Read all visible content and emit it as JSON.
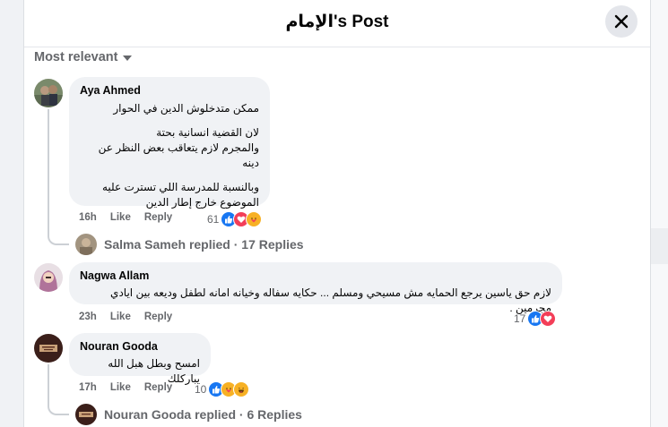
{
  "header": {
    "title": "الإمام's Post",
    "close_icon": "close-icon"
  },
  "sort": {
    "label": "Most relevant"
  },
  "comments": [
    {
      "author": "Aya Ahmed",
      "lines": [
        "ممكن متدخلوش الدين في الحوار",
        "لان القضية انسانية بحتة",
        "والمجرم لازم يتعاقب بعض النظر عن دينه",
        "وبالنسبة للمدرسة اللي تسترت عليه",
        "الموضوع خارج إطار الدين"
      ],
      "time": "16h",
      "like": "Like",
      "reply": "Reply",
      "reactions": "61",
      "replies": {
        "text": "Salma Sameh replied · 17 Replies"
      }
    },
    {
      "author": "Nagwa Allam",
      "lines": [
        "لازم حق ياسين يرجع الحمايه مش مسيحي ومسلم ... حكايه سفاله وخيانه امانه لطفل وديعه بين ايادي مجرمين ."
      ],
      "time": "23h",
      "like": "Like",
      "reply": "Reply",
      "reactions": "17"
    },
    {
      "author": "Nouran Gooda",
      "lines": [
        "امسح وبطل هبل الله يباركلك"
      ],
      "time": "17h",
      "like": "Like",
      "reply": "Reply",
      "reactions": "10",
      "replies": {
        "text": "Nouran Gooda replied · 6 Replies"
      }
    }
  ],
  "colors": {
    "like_blue": "#1877f2",
    "love_red": "#f33e58",
    "care_yellow": "#f7b125",
    "muted": "#65676b"
  }
}
